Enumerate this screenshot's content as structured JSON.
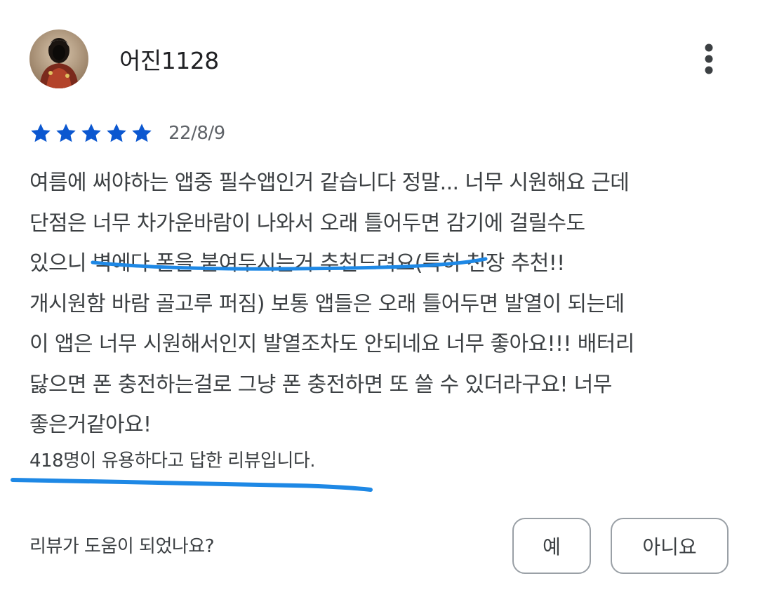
{
  "review": {
    "reviewer_name": "어진1128",
    "rating": 5,
    "rating_max": 5,
    "date": "22/8/9",
    "body_lines": [
      "여름에 써야하는 앱중 필수앱인거 같습니다 정말... 너무 시원해요 근데",
      "단점은 너무 차가운바람이 나와서 오래 틀어두면 감기에 걸릴수도",
      "있으니 벽에다 폰을 붙여두시는거 추천드려요(특히 천장 추천!!",
      "개시원함 바람 골고루 퍼짐) 보통 앱들은 오래 틀어두면 발열이 되는데",
      "이 앱은 너무 시원해서인지 발열조차도 안되네요 너무 좋아요!!! 배터리",
      "닳으면 폰 충전하는걸로 그냥 폰 충전하면 또 쓸 수 있더라구요! 너무",
      "좋은거같아요!"
    ],
    "helpful_text": "418명이 유용하다고 답한 리뷰입니다."
  },
  "feedback": {
    "question": "리뷰가 도움이 되었나요?",
    "yes_label": "예",
    "no_label": "아니요"
  },
  "icons": {
    "more": "more-vert-icon",
    "star": "star-icon",
    "avatar": "avatar-image"
  },
  "colors": {
    "star": "#0b57d0",
    "annotation": "#1e88e5",
    "text": "#3c4043",
    "button_border": "#9aa0a6"
  }
}
